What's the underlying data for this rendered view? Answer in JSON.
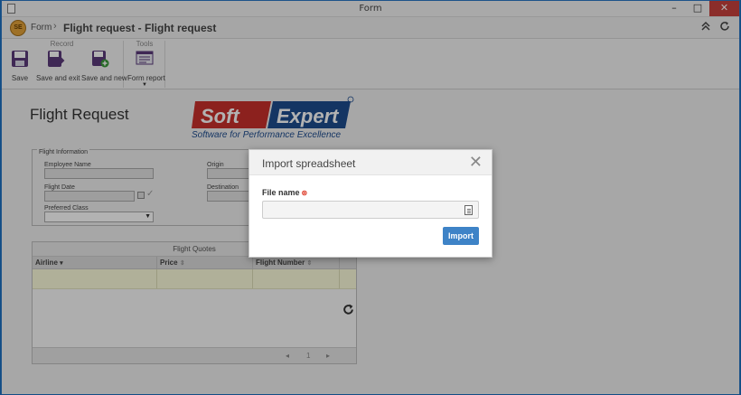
{
  "window": {
    "title": "Form",
    "min_glyph": "–",
    "max_glyph": "□",
    "close_glyph": "✕"
  },
  "header": {
    "badge": "SE",
    "crumb_root": "Form",
    "crumb_sep": "›",
    "title": "Flight request - Flight request"
  },
  "ribbon": {
    "groups": {
      "record": "Record",
      "tools": "Tools"
    },
    "buttons": {
      "save": "Save",
      "save_exit": "Save and exit",
      "save_new": "Save and new",
      "form_report": "Form report"
    }
  },
  "form": {
    "title": "Flight Request",
    "logo": {
      "soft": "Soft",
      "expert": "Expert",
      "tagline": "Software for Performance Excellence"
    },
    "section_legend": "Flight Information",
    "fields": {
      "employee_name": "Employee Name",
      "origin": "Origin",
      "flight_date": "Flight Date",
      "destination": "Destination",
      "preferred_class": "Preferred Class"
    },
    "grid": {
      "title": "Flight Quotes",
      "columns": [
        "Airline",
        "Price",
        "Flight Number"
      ],
      "pager": {
        "prev": "◂",
        "page": "1",
        "next": "▸"
      }
    }
  },
  "dialog": {
    "title": "Import spreadsheet",
    "file_label": "File name",
    "required_mark": "⊛",
    "button": "Import",
    "close_glyph": "✕"
  },
  "colors": {
    "primary": "#3e83c7",
    "close": "#c7413d",
    "logo_red": "#c9302c",
    "logo_blue": "#1e4c8f"
  }
}
